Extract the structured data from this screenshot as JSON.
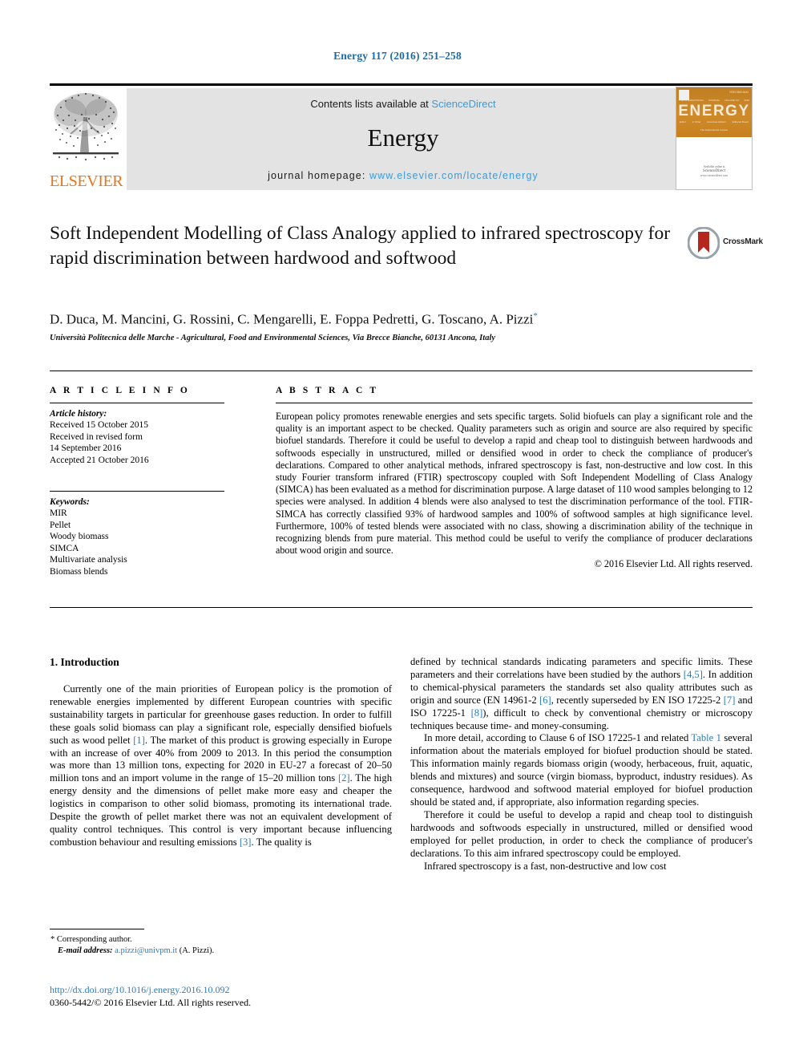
{
  "running_head": "Energy 117 (2016) 251–258",
  "masthead": {
    "publisher_name": "ELSEVIER",
    "contents_prefix": "Contents lists available at ",
    "contents_link": "ScienceDirect",
    "journal_name": "Energy",
    "homepage_prefix": "journal homepage: ",
    "homepage_url": "www.elsevier.com/locate/energy",
    "cover": {
      "title": "ENERGY",
      "top_label": "ISSN 0360-5442",
      "subrow_top": [
        "THE INTERNATIONAL",
        "JOURNAL",
        "VOLUME 117",
        "2016"
      ],
      "subrow_bottom": [
        "Editor",
        "in Chief",
        "Associate Editors",
        "Editorial Board"
      ],
      "tagline": "The International Journal",
      "bottom_line1": "Available online at",
      "bottom_line2": "ScienceDirect",
      "bottom_line3": "www.sciencedirect.com"
    }
  },
  "article": {
    "title": "Soft Independent Modelling of Class Analogy applied to infrared spectroscopy for rapid discrimination between hardwood and softwood",
    "crossmark_label": "CrossMark",
    "authors": "D. Duca, M. Mancini, G. Rossini, C. Mengarelli, E. Foppa Pedretti, G. Toscano, A. Pizzi",
    "author_marker": "*",
    "affiliation": "Università Politecnica delle Marche - Agricultural, Food and Environmental Sciences, Via Brecce Bianche, 60131 Ancona, Italy"
  },
  "article_info": {
    "heading": "A R T I C L E   I N F O",
    "history_label": "Article history:",
    "history_lines": [
      "Received 15 October 2015",
      "Received in revised form",
      "14 September 2016",
      "Accepted 21 October 2016"
    ],
    "keywords_label": "Keywords:",
    "keywords": [
      "MIR",
      "Pellet",
      "Woody biomass",
      "SIMCA",
      "Multivariate analysis",
      "Biomass blends"
    ]
  },
  "abstract": {
    "heading": "A B S T R A C T",
    "text": "European policy promotes renewable energies and sets specific targets. Solid biofuels can play a significant role and the quality is an important aspect to be checked. Quality parameters such as origin and source are also required by specific biofuel standards. Therefore it could be useful to develop a rapid and cheap tool to distinguish between hardwoods and softwoods especially in unstructured, milled or densified wood in order to check the compliance of producer's declarations. Compared to other analytical methods, infrared spectroscopy is fast, non-destructive and low cost. In this study Fourier transform infrared (FTIR) spectroscopy coupled with Soft Independent Modelling of Class Analogy (SIMCA) has been evaluated as a method for discrimination purpose. A large dataset of 110 wood samples belonging to 12 species were analysed. In addition 4 blends were also analysed to test the discrimination performance of the tool. FTIR-SIMCA has correctly classified 93% of hardwood samples and 100% of softwood samples at high significance level. Furthermore, 100% of tested blends were associated with no class, showing a discrimination ability of the technique in recognizing blends from pure material. This method could be useful to verify the compliance of producer declarations about wood origin and source.",
    "copyright": "© 2016 Elsevier Ltd. All rights reserved."
  },
  "introduction": {
    "section_number_title": "1.  Introduction",
    "left_paragraph_1_a": "Currently one of the main priorities of European policy is the promotion of renewable energies implemented by different European countries with specific sustainability targets in particular for greenhouse gases reduction. In order to fulfill these goals solid biomass can play a significant role, especially densified biofuels such as wood pellet ",
    "left_ref_1": "[1]",
    "left_paragraph_1_b": ". The market of this product is growing especially in Europe with an increase of over 40% from 2009 to 2013. In this period the consumption was more than 13 million tons, expecting for 2020 in EU-27 a forecast of 20–50 million tons and an import volume in the range of 15–20 million tons ",
    "left_ref_2": "[2]",
    "left_paragraph_1_c": ". The high energy density and the dimensions of pellet make more easy and cheaper the logistics in comparison to other solid biomass, promoting its international trade. Despite the growth of pellet market there was not an equivalent development of quality control techniques. This control is very important because influencing combustion behaviour and resulting emissions ",
    "left_ref_3": "[3]",
    "left_paragraph_1_d": ". The quality is",
    "right_paragraph_1_a": "defined by technical standards indicating parameters and specific limits. These parameters and their correlations have been studied by the authors ",
    "right_ref_45": "[4,5]",
    "right_paragraph_1_b": ". In addition to chemical-physical parameters the standards set also quality attributes such as origin and source (EN 14961-2 ",
    "right_ref_6": "[6]",
    "right_paragraph_1_c": ", recently superseded by EN ISO 17225-2 ",
    "right_ref_7": "[7]",
    "right_paragraph_1_d": " and ISO 17225-1 ",
    "right_ref_8": "[8]",
    "right_paragraph_1_e": "), difficult to check by conventional chemistry or microscopy techniques because time- and money-consuming.",
    "right_paragraph_2_a": "In more detail, according to Clause 6 of ISO 17225-1 and related ",
    "right_table_link": "Table 1",
    "right_paragraph_2_b": " several information about the materials employed for biofuel production should be stated. This information mainly regards biomass origin (woody, herbaceous, fruit, aquatic, blends and mixtures) and source (virgin biomass, byproduct, industry residues). As consequence, hardwood and softwood material employed for biofuel production should be stated and, if appropriate, also information regarding species.",
    "right_paragraph_3": "Therefore it could be useful to develop a rapid and cheap tool to distinguish hardwoods and softwoods especially in unstructured, milled or densified wood employed for pellet production, in order to check the compliance of producer's declarations. To this aim infrared spectroscopy could be employed.",
    "right_paragraph_4": "Infrared spectroscopy is a fast, non-destructive and low cost"
  },
  "footer": {
    "corresponding_author": "Corresponding author.",
    "email_label": "E-mail address:",
    "email": "a.pizzi@univpm.it",
    "email_suffix": "(A. Pizzi).",
    "doi": "http://dx.doi.org/10.1016/j.energy.2016.10.092",
    "issn_line": "0360-5442/© 2016 Elsevier Ltd. All rights reserved."
  },
  "colors": {
    "link_blue": "#2b7bb9",
    "science_direct_blue": "#3d9bd4",
    "elsevier_orange": "#E8761A",
    "cover_orange": "#c8801f",
    "crossmark_red": "#b5261e"
  }
}
